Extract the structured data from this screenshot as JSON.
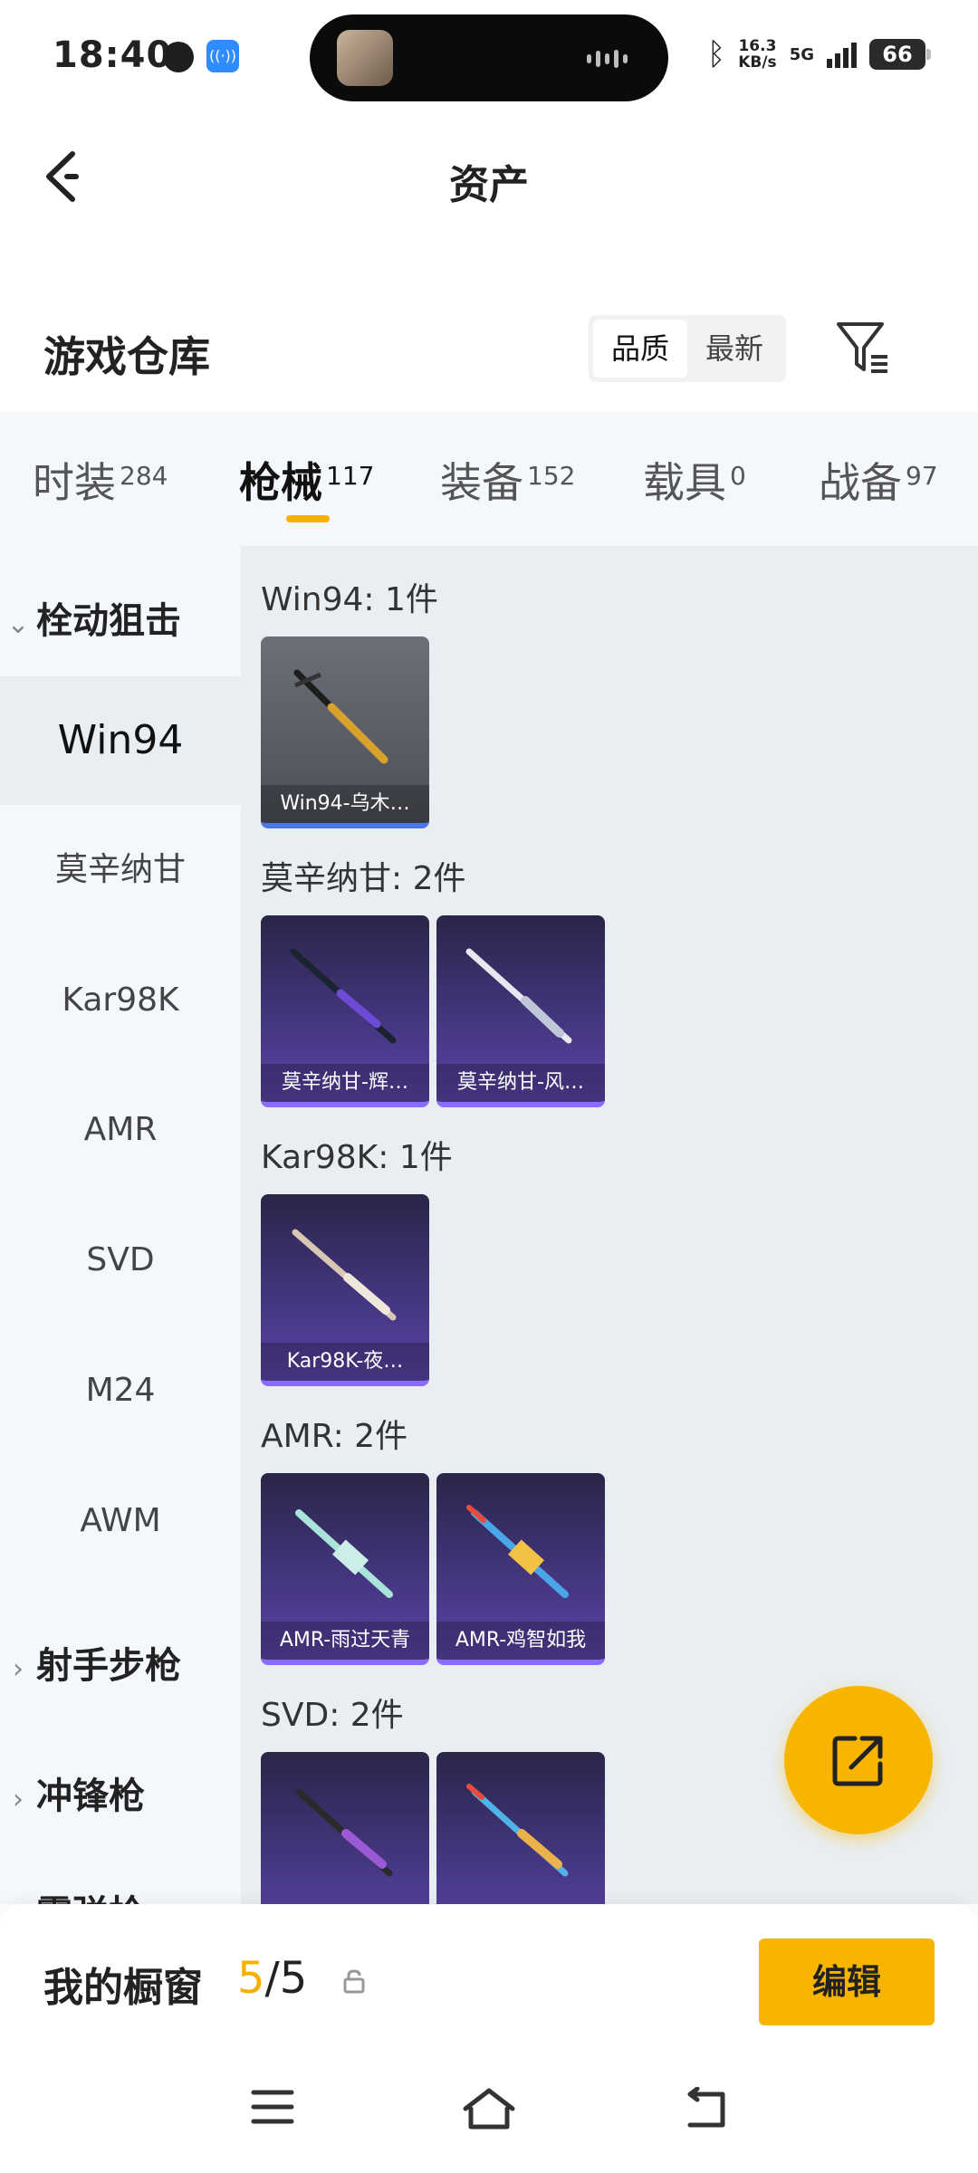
{
  "status_bar": {
    "time": "18:40",
    "speed_value": "16.3",
    "speed_unit": "KB/s",
    "network": "5G",
    "battery": "66"
  },
  "header": {
    "title": "资产"
  },
  "section": {
    "title": "游戏仓库",
    "sort_options": [
      "品质",
      "最新"
    ],
    "active_sort": "品质"
  },
  "tabs": [
    {
      "label": "时装",
      "count": "284"
    },
    {
      "label": "枪械",
      "count": "117"
    },
    {
      "label": "装备",
      "count": "152"
    },
    {
      "label": "载具",
      "count": "0"
    },
    {
      "label": "战备",
      "count": "97"
    }
  ],
  "active_tab": "枪械",
  "sidebar": {
    "groups": [
      {
        "label": "栓动狙击",
        "expanded": true
      },
      {
        "label": "射手步枪",
        "expanded": false
      },
      {
        "label": "冲锋枪",
        "expanded": false
      },
      {
        "label": "霰弹枪",
        "expanded": false
      }
    ],
    "items": [
      "Win94",
      "莫辛纳甘",
      "Kar98K",
      "AMR",
      "SVD",
      "M24",
      "AWM"
    ],
    "active_item": "Win94"
  },
  "content": {
    "groups": [
      {
        "label": "Win94: 1件",
        "cards": [
          {
            "caption": "Win94-乌木…",
            "rarity": "blue"
          }
        ]
      },
      {
        "label": "莫辛纳甘: 2件",
        "cards": [
          {
            "caption": "莫辛纳甘-辉…",
            "rarity": "purple"
          },
          {
            "caption": "莫辛纳甘-风…",
            "rarity": "purple"
          }
        ]
      },
      {
        "label": "Kar98K: 1件",
        "cards": [
          {
            "caption": "Kar98K-夜…",
            "rarity": "purple"
          }
        ]
      },
      {
        "label": "AMR: 2件",
        "cards": [
          {
            "caption": "AMR-雨过天青",
            "rarity": "purple"
          },
          {
            "caption": "AMR-鸡智如我",
            "rarity": "purple"
          }
        ]
      },
      {
        "label": "SVD: 2件",
        "cards": [
          {
            "caption": "",
            "rarity": "purple"
          },
          {
            "caption": "",
            "rarity": "purple"
          }
        ]
      }
    ]
  },
  "bottom_bar": {
    "showcase_label": "我的橱窗",
    "showcase_current": "5",
    "showcase_total": "/5",
    "edit_label": "编辑"
  },
  "colors": {
    "accent": "#f7b500",
    "sidebar_bg": "#f4f8fc",
    "content_bg": "#e9eef3"
  },
  "icons": [
    "back-icon",
    "filter-icon",
    "share-edit-icon",
    "lock-icon",
    "menu-icon",
    "home-icon",
    "back-nav-icon"
  ]
}
